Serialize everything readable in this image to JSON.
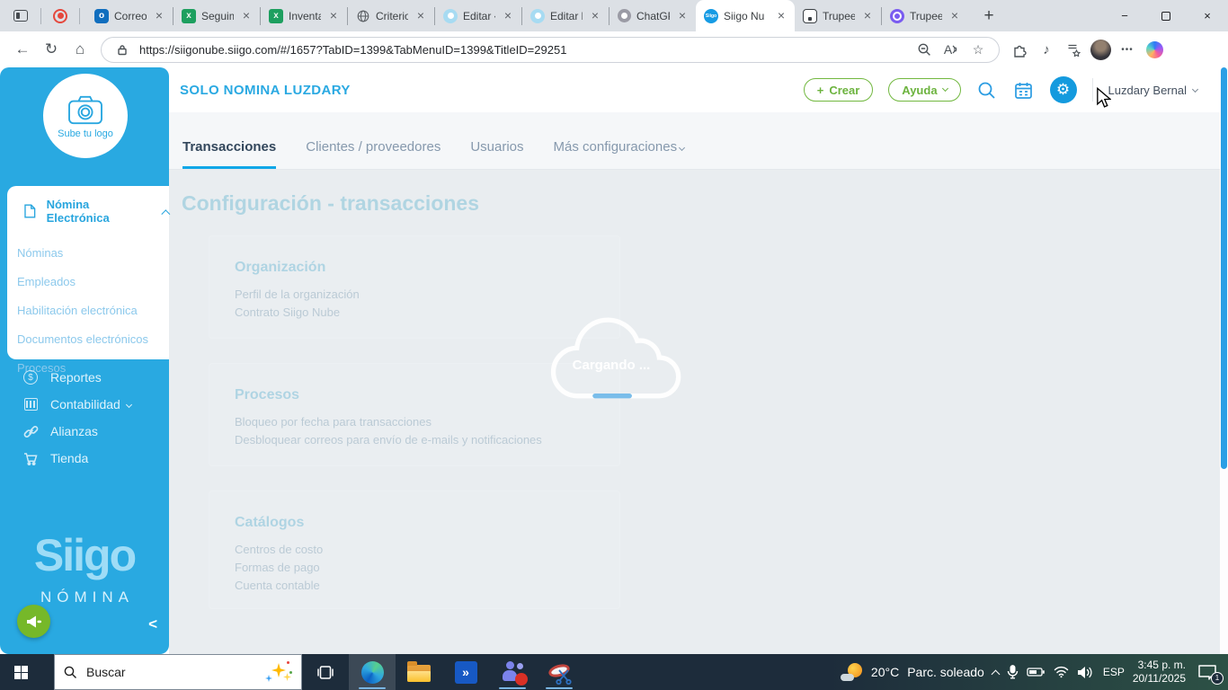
{
  "colors": {
    "siigo_blue": "#29a9e1",
    "accent_green": "#72b840",
    "tab_underline": "#0fa7e8",
    "scrollbar_thumb": "#2a9fe5",
    "gear_active_bg": "#149ade",
    "taskbar_bg": "#1d2c3b",
    "loading_arc": "#79bdea"
  },
  "icons": {
    "gear": "⚙",
    "plus": "+",
    "close": "×",
    "back_arrow": "←",
    "refresh": "↻",
    "home": "⌂",
    "star": "☆",
    "music_note": "♪",
    "overflow_dots": "•••",
    "minimize": "−",
    "new_tab": "+",
    "collapse_left": "<",
    "read_aloud": "A",
    "chevrons_right": "»"
  },
  "browser": {
    "tabs": [
      {
        "title": "Correo:"
      },
      {
        "title": "Seguimi"
      },
      {
        "title": "Inventar"
      },
      {
        "title": "Criterios"
      },
      {
        "title": "Editar «F"
      },
      {
        "title": "Editar la"
      },
      {
        "title": "ChatGPT"
      },
      {
        "title": "Siigo Nu",
        "active": true
      },
      {
        "title": "Trupeer."
      },
      {
        "title": "Trupeer."
      }
    ],
    "url": "https://siigonube.siigo.com/#/1657?TabID=1399&TabMenuID=1399&TitleID=29251"
  },
  "header": {
    "title": "SOLO NOMINA LUZDARY",
    "create_label": "Crear",
    "help_label": "Ayuda",
    "user_name": "Luzdary Bernal"
  },
  "config_tabs": {
    "items": [
      "Transacciones",
      "Clientes / proveedores",
      "Usuarios",
      "Más configuraciones"
    ]
  },
  "sidebar": {
    "upload_logo": "Sube tu logo",
    "section_title": "Nómina Electrónica",
    "items": [
      "Nóminas",
      "Empleados",
      "Habilitación electrónica",
      "Documentos electrónicos",
      "Procesos"
    ],
    "nav": [
      "Reportes",
      "Contabilidad",
      "Alianzas",
      "Tienda"
    ],
    "brand": "Siigo",
    "brand_sub": "NÓMINA"
  },
  "content": {
    "page_title": "Configuración - transacciones",
    "loading_text": "Cargando ...",
    "cards": [
      {
        "title": "Organización",
        "links": [
          "Perfil de la organización",
          "Contrato Siigo Nube"
        ]
      },
      {
        "title": "Procesos",
        "links": [
          "Bloqueo por fecha para transacciones",
          "Desbloquear correos para envío de e-mails y notificaciones"
        ]
      },
      {
        "title": "Catálogos",
        "links": [
          "Centros de costo",
          "Formas de pago",
          "Cuenta contable"
        ]
      }
    ]
  },
  "taskbar": {
    "search_placeholder": "Buscar",
    "weather_temp": "20°C",
    "weather_desc": "Parc. soleado",
    "language": "ESP",
    "time": "3:45 p. m.",
    "date": "20/11/2025",
    "notification_count": "1"
  }
}
